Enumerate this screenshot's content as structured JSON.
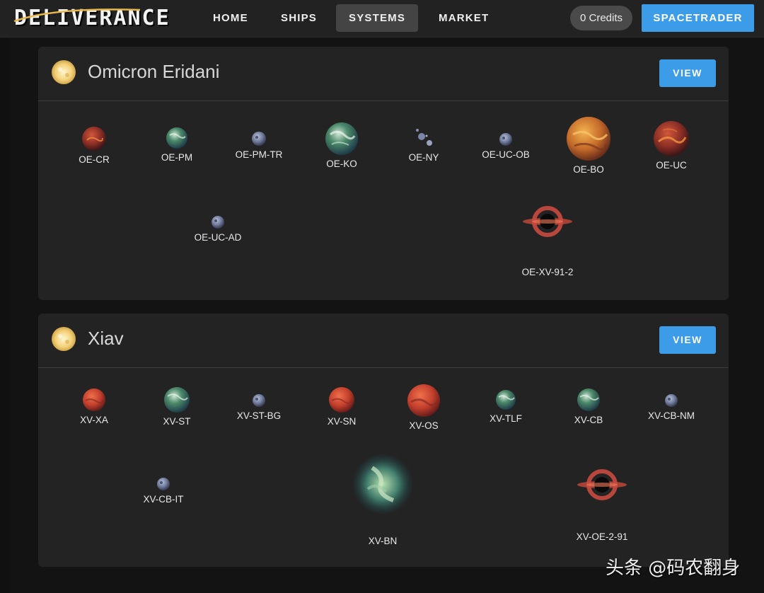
{
  "nav": {
    "logo": "DELIVERANCE",
    "items": [
      "HOME",
      "SHIPS",
      "SYSTEMS",
      "MARKET"
    ],
    "active_index": 2,
    "credits": "0 Credits",
    "cta": "SPACETRADER"
  },
  "systems": [
    {
      "name": "Omicron Eridani",
      "view_label": "VIEW",
      "bodies": [
        {
          "label": "OE-CR",
          "icon": "lava-planet-icon"
        },
        {
          "label": "OE-PM",
          "icon": "earthlike-planet-icon"
        },
        {
          "label": "OE-PM-TR",
          "icon": "moon-icon"
        },
        {
          "label": "OE-KO",
          "icon": "earthlike-planet-icon"
        },
        {
          "label": "OE-NY",
          "icon": "asteroid-field-icon"
        },
        {
          "label": "OE-UC-OB",
          "icon": "moon-icon"
        },
        {
          "label": "OE-BO",
          "icon": "gas-giant-icon"
        },
        {
          "label": "OE-UC",
          "icon": "lava-planet-icon"
        },
        {
          "label": "OE-UC-AD",
          "icon": "moon-icon"
        },
        {
          "label": "OE-XV-91-2",
          "icon": "wormhole-icon"
        }
      ]
    },
    {
      "name": "Xiav",
      "view_label": "VIEW",
      "bodies": [
        {
          "label": "XV-XA",
          "icon": "red-planet-icon"
        },
        {
          "label": "XV-ST",
          "icon": "earthlike-planet-icon"
        },
        {
          "label": "XV-ST-BG",
          "icon": "moon-icon"
        },
        {
          "label": "XV-SN",
          "icon": "red-planet-icon"
        },
        {
          "label": "XV-OS",
          "icon": "red-planet-icon"
        },
        {
          "label": "XV-TLF",
          "icon": "earthlike-planet-icon"
        },
        {
          "label": "XV-CB",
          "icon": "earthlike-planet-icon"
        },
        {
          "label": "XV-CB-NM",
          "icon": "moon-icon"
        },
        {
          "label": "XV-CB-IT",
          "icon": "moon-icon"
        },
        {
          "label": "XV-BN",
          "icon": "nebula-icon"
        },
        {
          "label": "XV-OE-2-91",
          "icon": "wormhole-icon"
        }
      ]
    }
  ],
  "watermark": "头条 @码农翻身",
  "colors": {
    "accent": "#3d9ce8",
    "panel": "#232323",
    "background": "#131313",
    "topbar": "#222222"
  }
}
